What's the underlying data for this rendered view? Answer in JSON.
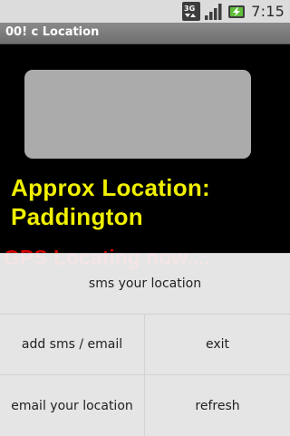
{
  "status_bar": {
    "network_label": "3G",
    "time": "7:15",
    "icons": [
      "3g-data-icon",
      "signal-strength-icon",
      "battery-charging-icon"
    ]
  },
  "app": {
    "title": "00! c Location"
  },
  "location": {
    "approx_label": "Approx Location:",
    "place": "Paddington",
    "gps_status": "GPS Locating now...."
  },
  "menu": {
    "items": [
      {
        "label": "sms your location"
      },
      {
        "label": "add sms / email"
      },
      {
        "label": "exit"
      },
      {
        "label": "email your location"
      },
      {
        "label": "refresh"
      }
    ]
  },
  "colors": {
    "background": "#000000",
    "location_text": "#f0f000",
    "gps_status_text": "#d10000",
    "map_placeholder": "#ababab",
    "menu_background": "#f6f6f6"
  }
}
